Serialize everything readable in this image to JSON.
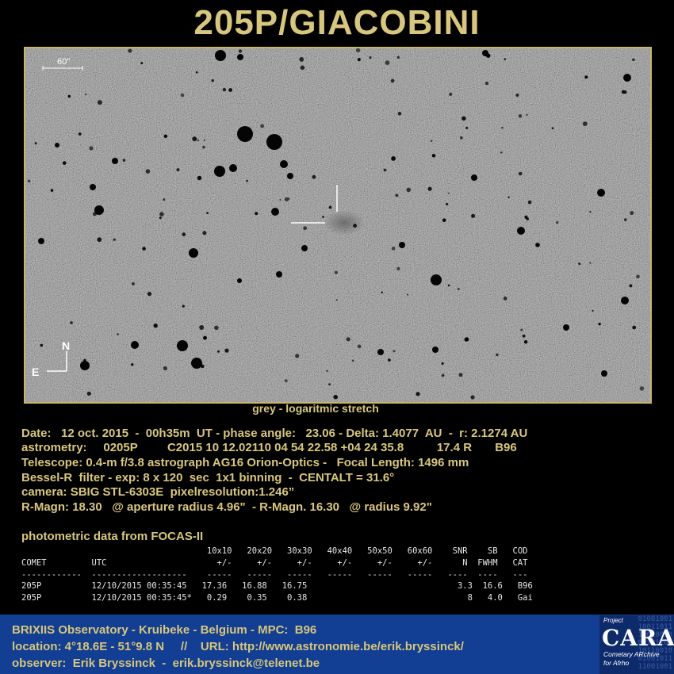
{
  "title": "205P/GIACOBINI",
  "image": {
    "scale_label": "60\"",
    "compass_n": "N",
    "compass_e": "E",
    "caption": "grey -  logaritmic stretch"
  },
  "info_lines": [
    "Date:   12 oct. 2015  -  00h35m  UT - phase angle:   23.06 - Delta: 1.4077  AU  -  r: 2.1274 AU",
    "astrometry:     0205P         C2015 10 12.02110 04 54 22.58 +04 24 35.8          17.4 R       B96",
    "Telescope: 0.4-m f/3.8 astrograph AG16 Orion-Optics -   Focal Length: 1496 mm",
    "Bessel-R  filter - exp: 8 x 120  sec  1x1 binning  -  CENTALT = 31.6°",
    "camera: SBIG STL-6303E  pixelresolution:1.246”",
    "R-Magn: 18.30   @ aperture radius 4.96\"  - R-Magn. 16.30   @ radius 9.92\""
  ],
  "photometry": {
    "title": "photometric data from FOCAS-II",
    "lines": [
      "                                     10x10   20x20   30x30   40x40   50x50   60x60    SNR    SB   COD",
      "COMET         UTC                      +/-     +/-     +/-     +/-     +/-     +/-      N  FWHM   CAT",
      "------------  -------------------    -----   -----   -----   -----   -----   -----   ----  ----   ---",
      "205P          12/10/2015 00:35:45   17.36   16.88   16.75                              3.3  16.6   B96",
      "205P          12/10/2015 00:35:45*   0.29    0.35    0.38                                8   4.0   Gai"
    ]
  },
  "footer": {
    "line1": "BRIXIIS Observatory - Kruibeke - Belgium - MPC:  B96",
    "line2": "location: 4°18.6E - 51°9.8 N     //    URL: http://www.astronomie.be/erik.bryssinck/",
    "line3": "observer:  Erik Bryssinck  -  erik.bryssinck@telenet.be"
  },
  "cara_logo": {
    "project": "Project",
    "name": "CARA",
    "subtitle_1": "Cometary ARchive",
    "subtitle_2": "for Afrho",
    "bits": "01001001\n10011011\n11010010\n00101101\n10110010\n01001011\n11001001"
  },
  "colors": {
    "accent_gold": "#d8c77a",
    "frame_border": "#c9b46a",
    "footer_blue": "#123e93",
    "sky_grey": "#7d7d7d"
  }
}
